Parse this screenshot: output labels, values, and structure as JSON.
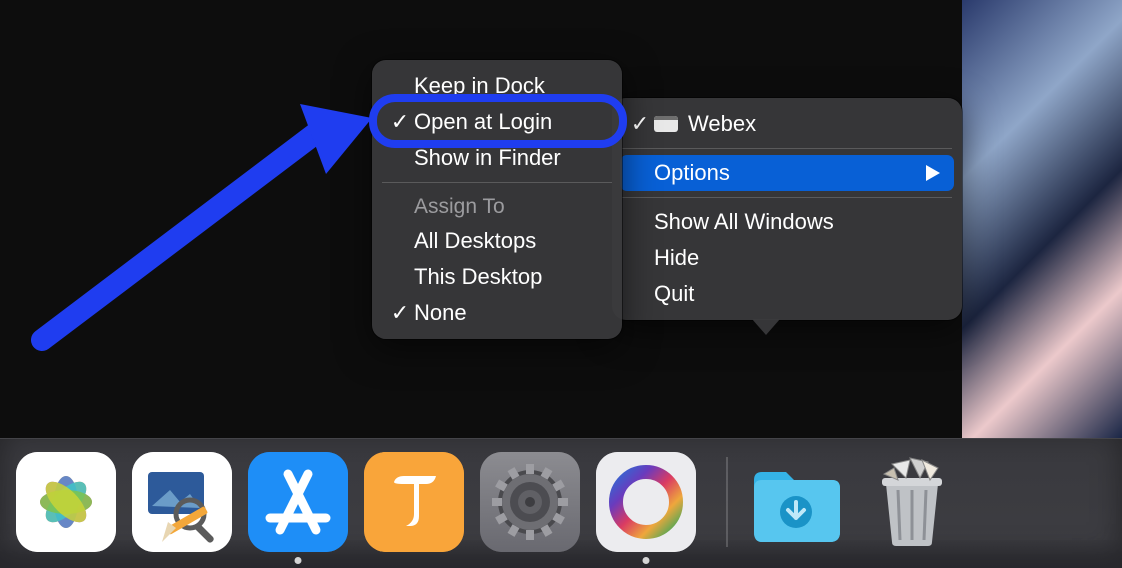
{
  "app_menu": {
    "window_item": "Webex",
    "options": "Options",
    "show_all_windows": "Show All Windows",
    "hide": "Hide",
    "quit": "Quit"
  },
  "options_submenu": {
    "keep_in_dock": "Keep in Dock",
    "open_at_login": "Open at Login",
    "show_in_finder": "Show in Finder",
    "assign_to_header": "Assign To",
    "all_desktops": "All Desktops",
    "this_desktop": "This Desktop",
    "none": "None"
  },
  "annotation": {
    "target": "Open at Login"
  },
  "dock": {
    "apps": [
      {
        "name": "Photos"
      },
      {
        "name": "Preview"
      },
      {
        "name": "App Store",
        "running": true
      },
      {
        "name": "T App"
      },
      {
        "name": "System Settings"
      },
      {
        "name": "Webex",
        "running": true
      }
    ],
    "right": [
      {
        "name": "Downloads"
      },
      {
        "name": "Trash"
      }
    ]
  }
}
